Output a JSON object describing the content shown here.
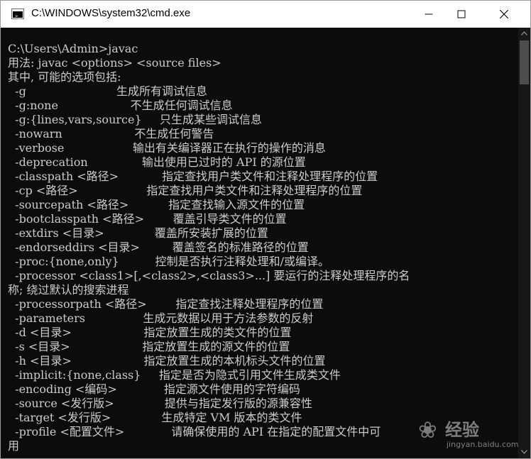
{
  "window": {
    "title": "C:\\WINDOWS\\system32\\cmd.exe",
    "icon": "cmd-icon"
  },
  "titlebar_controls": {
    "minimize_icon": "minimize-icon",
    "maximize_icon": "maximize-icon",
    "close_icon": "close-icon"
  },
  "colors": {
    "console_background": "#0c0c0c",
    "console_text": "#cccccc",
    "titlebar_background": "#ffffff"
  },
  "console": {
    "lines": [
      "C:\\Users\\Admin>javac",
      "用法: javac <options> <source files>",
      "其中, 可能的选项包括:",
      "  -g                         生成所有调试信息",
      "  -g:none                    不生成任何调试信息",
      "  -g:{lines,vars,source}     只生成某些调试信息",
      "  -nowarn                    不生成任何警告",
      "  -verbose                   输出有关编译器正在执行的操作的消息",
      "  -deprecation               输出使用已过时的 API 的源位置",
      "  -classpath <路径>            指定查找用户类文件和注释处理程序的位置",
      "  -cp <路径>                   指定查找用户类文件和注释处理程序的位置",
      "  -sourcepath <路径>           指定查找输入源文件的位置",
      "  -bootclasspath <路径>        覆盖引导类文件的位置",
      "  -extdirs <目录>              覆盖所安装扩展的位置",
      "  -endorseddirs <目录>         覆盖签名的标准路径的位置",
      "  -proc:{none,only}          控制是否执行注释处理和/或编译。",
      "  -processor <class1>[,<class2>,<class3>...] 要运行的注释处理程序的名",
      "称; 绕过默认的搜索进程",
      "  -processorpath <路径>        指定查找注释处理程序的位置",
      "  -parameters                生成元数据以用于方法参数的反射",
      "  -d <目录>                    指定放置生成的类文件的位置",
      "  -s <目录>                    指定放置生成的源文件的位置",
      "  -h <目录>                    指定放置生成的本机标头文件的位置",
      "  -implicit:{none,class}     指定是否为隐式引用文件生成类文件",
      "  -encoding <编码>             指定源文件使用的字符编码",
      "  -source <发行版>              提供与指定发行版的源兼容性",
      "  -target <发行版>              生成特定 VM 版本的类文件",
      "  -profile <配置文件>             请确保使用的 API 在指定的配置文件中可",
      "用"
    ]
  },
  "watermark": {
    "text": "经验",
    "url": "jingyan.baidu.com"
  }
}
